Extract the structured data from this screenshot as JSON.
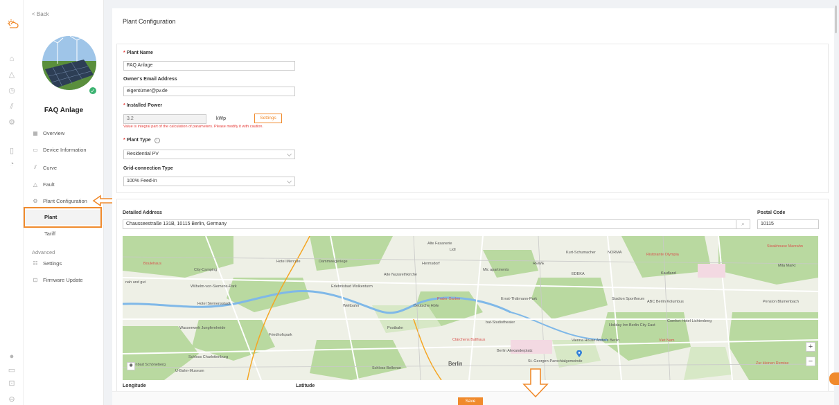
{
  "nav_back": "< Back",
  "plant_display_name": "FAQ Anlage",
  "menu": {
    "overview": "Overview",
    "device_information": "Device Information",
    "curve": "Curve",
    "fault": "Fault",
    "plant_configuration": "Plant Configuration",
    "plant": "Plant",
    "tariff": "Tariff",
    "advanced": "Advanced",
    "settings": "Settings",
    "firmware_update": "Firmware Update"
  },
  "page_title": "Plant Configuration",
  "form": {
    "plant_name_label": "Plant Name",
    "plant_name_value": "FAQ Anlage",
    "owner_email_label": "Owner's Email Address",
    "owner_email_value": "eigentümer@pv.de",
    "installed_power_label": "Installed Power",
    "installed_power_value": "3.2",
    "installed_power_unit": "kWp",
    "settings_button": "Settings",
    "installed_power_warning": "Value is integral part of the calculation of parameters. Please modify it with caution.",
    "plant_type_label": "Plant Type",
    "plant_type_value": "Residential PV",
    "grid_type_label": "Grid-connection Type",
    "grid_type_value": "100% Feed-in",
    "detailed_address_label": "Detailed Address",
    "detailed_address_value": "Chausseestraße 131B, 10115 Berlin, Germany",
    "postal_code_label": "Postal Code",
    "postal_code_value": "10115",
    "longitude_label": "Longitude",
    "latitude_label": "Latitude",
    "save_button": "Save"
  },
  "map_labels": {
    "alte_fasanerie": "Alte Fasanerie",
    "lidl": "Lidl",
    "hermsdorf": "Hermsdorf",
    "norma": "NORMA",
    "kurt_schumacher": "Kurt-Schumacher",
    "ristorante": "Ristorante Olympia",
    "steakhouse": "Steakhouse Marzahn",
    "boulehaus": "Boulehaus",
    "city_camping": "City-Camping",
    "hotel_mercure": "Hotel Mercure",
    "dammweg": "Dammwegeriege",
    "alte_nazareth": "Alte Nazarethkirche",
    "mic_apartments": "Mic apartments",
    "rewe": "REWE",
    "edeka": "EDEKA",
    "kaufland": "Kaufland",
    "mila": "Mila Markt",
    "nah_und_gut": "nah und gut",
    "wilhelm_siemens": "Wilhelm-von-Siemens-Park",
    "erlebnisbad": "Erlebnisbad Wolkenturm",
    "prater": "Prater Garten",
    "ernst_thalmann": "Ernst-Thälmann-Park",
    "stadion": "Stadion Sportforum",
    "abc_berlin": "ABC Berlin Kolumbus",
    "pension": "Pension Blumenbach",
    "hotel_siemensstadt": "Hotel Siemensstadt",
    "weltbahn": "Weltbahn",
    "deutsche_hohe": "Deutsche Höfe",
    "bat_studio": "bat-Studiotheater",
    "hotel_lichtenberg": "Comfort Hotel Lichtenberg",
    "wesselmann": "Wasserwerk Jungfernheide",
    "ernst_tedel": "Friedhofspark",
    "postbahn": "Postbahn",
    "clarchens": "Clärchens Ballhaus",
    "berlin_alex": "Berlin Alexanderplatz",
    "vienna_house": "Vienna House Andel's Berlin",
    "hotel_city_east": "Holiday Inn Berlin City East",
    "viet_nam": "Viet Nam",
    "schloss": "Schloss Charlottenburg",
    "berlin": "Berlin",
    "st_georgen": "St. Georgen-Parochialgemeinde",
    "schloss_bellevue": "Schloss Bellevue",
    "zur_kleinen": "Zur kleinen Remise",
    "u_bahn_museum": "U-Bahn-Museum",
    "hallenbad": "Hallenbad Schöneberg"
  },
  "colors": {
    "accent": "#f08a2c",
    "error": "#e53935",
    "success": "#3cb371",
    "map_pin": "#2f7fd8"
  }
}
